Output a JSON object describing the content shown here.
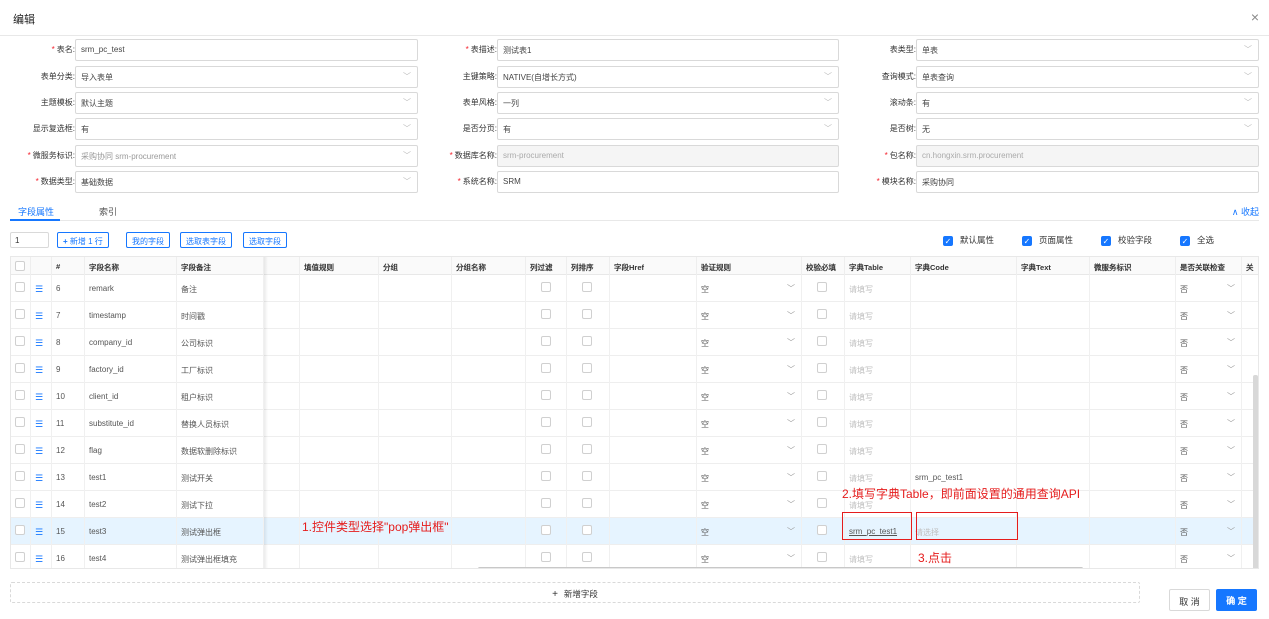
{
  "dialog": {
    "title": "编辑",
    "close_glyph": "×"
  },
  "form": {
    "row1": {
      "table_name": {
        "label": "表名:",
        "value": "srm_pc_test"
      },
      "table_desc": {
        "label": "表描述:",
        "value": "测试表1"
      },
      "table_type": {
        "label": "表类型:",
        "value": "单表"
      }
    },
    "row2": {
      "form_category": {
        "label": "表单分类:",
        "value": "导入表单"
      },
      "pk_strategy": {
        "label": "主键策略:",
        "value": "NATIVE(自增长方式)"
      },
      "query_mode": {
        "label": "查询模式:",
        "value": "单表查询"
      }
    },
    "row3": {
      "theme_template": {
        "label": "主题模板:",
        "value": "默认主题"
      },
      "form_style": {
        "label": "表单风格:",
        "value": "一列"
      },
      "scrollbar": {
        "label": "滚动条:",
        "value": "有"
      }
    },
    "row4": {
      "show_checkbox": {
        "label": "显示复选框:",
        "value": "有"
      },
      "paginate": {
        "label": "是否分页:",
        "value": "有"
      },
      "is_tree": {
        "label": "是否树:",
        "value": "无"
      }
    },
    "row5": {
      "microservice_id": {
        "label": "微服务标识:",
        "value": "采购协同   srm-procurement"
      },
      "db_name": {
        "label": "数据库名称:",
        "value": "srm-procurement"
      },
      "package_name": {
        "label": "包名称:",
        "value": "cn.hongxin.srm.procurement"
      }
    },
    "row6": {
      "data_type": {
        "label": "数据类型:",
        "value": "基础数据"
      },
      "system_name": {
        "label": "系统名称:",
        "value": "SRM"
      },
      "module_name": {
        "label": "模块名称:",
        "value": "采购协同"
      }
    }
  },
  "tabs": {
    "fields": "字段属性",
    "index": "索引",
    "collapse": "收起",
    "collapse_icon": "chevron-up"
  },
  "toolbar": {
    "row_count": "1",
    "add_row": "新增 1 行",
    "my_fields": "我的字段",
    "pick_table_fields": "选取表字段",
    "pick_fields": "选取字段",
    "opt_default": "默认属性",
    "opt_page": "页面属性",
    "opt_validate": "校验字段",
    "opt_all": "全选"
  },
  "columns": [
    "#",
    "字段名称",
    "字段备注",
    "填值规则",
    "分组",
    "分组名称",
    "列过滤",
    "列排序",
    "字段Href",
    "验证规则",
    "校验必填",
    "字典Table",
    "字典Code",
    "字典Text",
    "微服务标识",
    "是否关联检查",
    "关"
  ],
  "rows": [
    {
      "num": "6",
      "name": "remark",
      "comment": "备注",
      "rule": "空",
      "dict_table": "请填写",
      "dict_code": "",
      "assoc": "否"
    },
    {
      "num": "7",
      "name": "timestamp",
      "comment": "时间戳",
      "rule": "空",
      "dict_table": "请填写",
      "dict_code": "",
      "assoc": "否"
    },
    {
      "num": "8",
      "name": "company_id",
      "comment": "公司标识",
      "rule": "空",
      "dict_table": "请填写",
      "dict_code": "",
      "assoc": "否"
    },
    {
      "num": "9",
      "name": "factory_id",
      "comment": "工厂标识",
      "rule": "空",
      "dict_table": "请填写",
      "dict_code": "",
      "assoc": "否"
    },
    {
      "num": "10",
      "name": "client_id",
      "comment": "租户标识",
      "rule": "空",
      "dict_table": "请填写",
      "dict_code": "",
      "assoc": "否"
    },
    {
      "num": "11",
      "name": "substitute_id",
      "comment": "替换人员标识",
      "rule": "空",
      "dict_table": "请填写",
      "dict_code": "",
      "assoc": "否"
    },
    {
      "num": "12",
      "name": "flag",
      "comment": "数据软删除标识",
      "rule": "空",
      "dict_table": "请填写",
      "dict_code": "",
      "assoc": "否"
    },
    {
      "num": "13",
      "name": "test1",
      "comment": "测试开关",
      "rule": "空",
      "dict_table": "请填写",
      "dict_code": "srm_pc_test1",
      "assoc": "否"
    },
    {
      "num": "14",
      "name": "test2",
      "comment": "测试下拉",
      "rule": "空",
      "dict_table": "请填写",
      "dict_code": "",
      "assoc": "否"
    },
    {
      "num": "15",
      "name": "test3",
      "comment": "测试弹出框",
      "rule": "空",
      "dict_table": "srm_pc_test1",
      "dict_code": "请选择",
      "assoc": "否"
    },
    {
      "num": "16",
      "name": "test4",
      "comment": "测试弹出框填充",
      "rule": "空",
      "dict_table": "请填写",
      "dict_code": "",
      "assoc": "否"
    }
  ],
  "annotations": {
    "a1": "1.控件类型选择\"pop弹出框\"",
    "a2": "2.填写字典Table，即前面设置的通用查询API",
    "a3": "3.点击"
  },
  "footer": {
    "add_field": "新增字段",
    "cancel": "取 消",
    "ok": "确 定"
  },
  "colors": {
    "primary": "#1677ff",
    "annotation": "#e51c1c",
    "highlight_row": "#e6f4ff"
  }
}
